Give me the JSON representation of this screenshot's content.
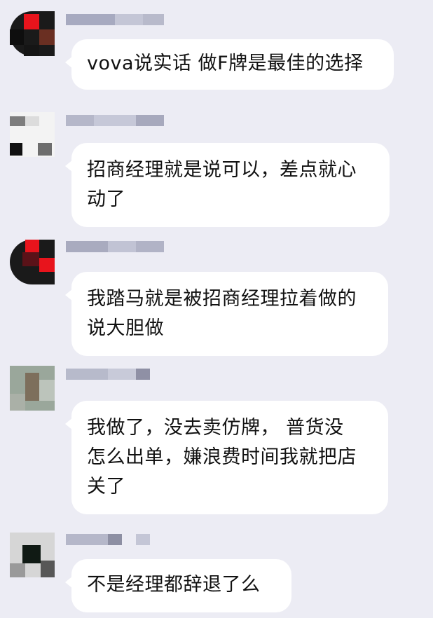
{
  "messages": [
    {
      "lines": [
        "vova说实话 做F牌是最佳的选择"
      ]
    },
    {
      "lines": [
        "招商经理就是说可以，差点就心",
        "动了"
      ]
    },
    {
      "lines": [
        "我踏马就是被招商经理拉着做的",
        "说大胆做"
      ]
    },
    {
      "lines": [
        "我做了，没去卖仿牌，  普货没",
        "怎么出单，嫌浪费时间我就把店",
        "关了"
      ]
    },
    {
      "lines": [
        "不是经理都辞退了么"
      ]
    }
  ]
}
